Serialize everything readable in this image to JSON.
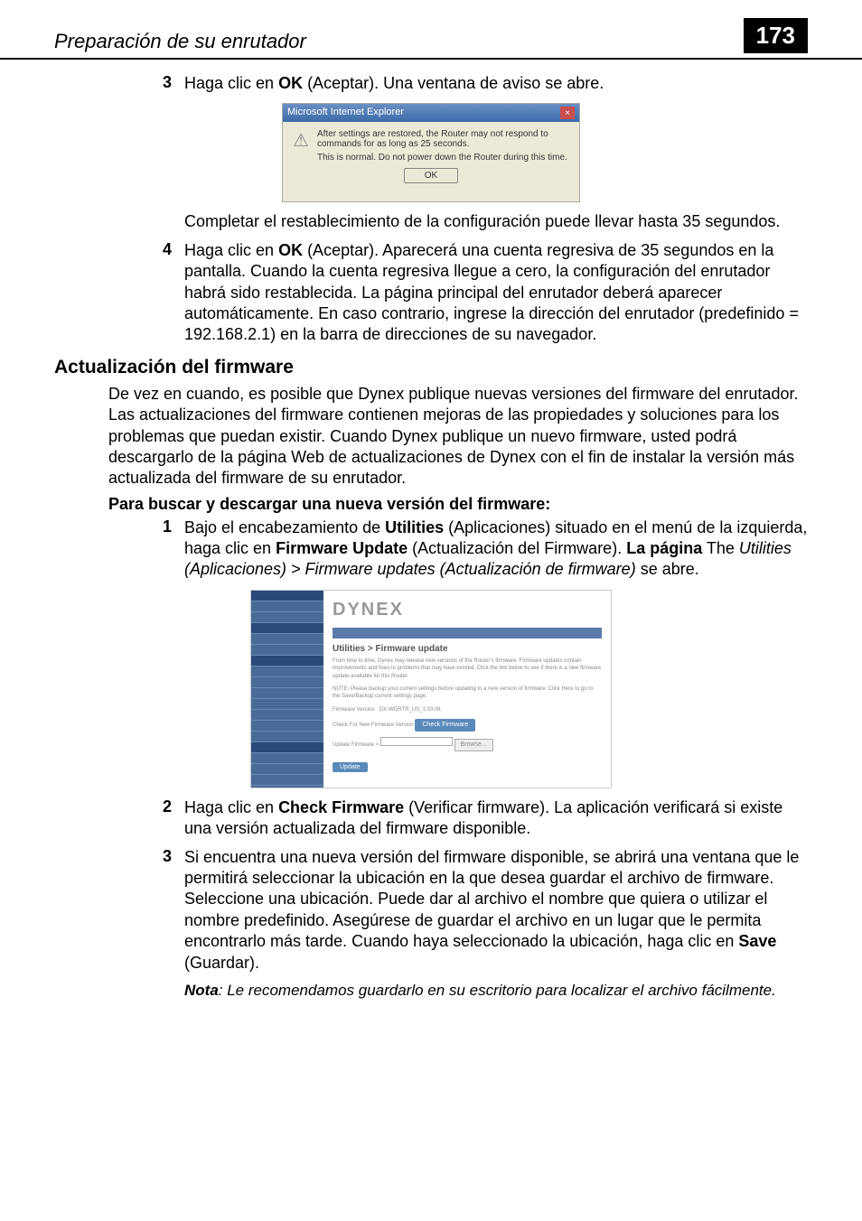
{
  "header": {
    "title": "Preparación de su enrutador",
    "page_number": "173"
  },
  "step3": {
    "number": "3",
    "prefix": "Haga clic en ",
    "bold": "OK",
    "suffix": " (Aceptar). Una ventana de aviso se abre."
  },
  "dialog": {
    "title": "Microsoft Internet Explorer",
    "line1": "After settings are restored, the Router may not respond to commands for as long as 25 seconds.",
    "line2": "This is normal. Do not power down the Router during this time.",
    "button": "OK"
  },
  "after_dialog": "Completar el restablecimiento de la configuración puede llevar hasta 35 segundos.",
  "step4": {
    "number": "4",
    "prefix": "Haga clic en ",
    "bold": "OK",
    "suffix": " (Aceptar). Aparecerá una cuenta regresiva de 35 segundos en la pantalla. Cuando la cuenta regresiva llegue a cero, la configuración del enrutador habrá sido restablecida. La página principal del enrutador deberá aparecer automáticamente. En caso contrario, ingrese la dirección del enrutador (predefinido = 192.168.2.1) en la barra de direcciones de su navegador."
  },
  "firmware_heading": "Actualización del firmware",
  "firmware_para": "De vez en cuando, es posible que Dynex publique nuevas versiones del firmware del enrutador. Las actualizaciones del firmware contienen mejoras de las propiedades y soluciones para los problemas que puedan existir. Cuando Dynex publique un nuevo firmware, usted podrá descargarlo de la página Web de actualizaciones de Dynex con el fin de instalar la versión más actualizada del firmware de su enrutador.",
  "firmware_subheading": "Para buscar y descargar una nueva versión del firmware:",
  "fw_step1": {
    "number": "1",
    "part1": "Bajo el encabezamiento de ",
    "bold1": "Utilities",
    "part2": " (Aplicaciones) situado en el menú de la izquierda, haga clic en ",
    "bold2": "Firmware Update",
    "part3": " (Actualización del Firmware). ",
    "bold3": "La página",
    "part4": " The ",
    "ital1": "Utilities (Aplicaciones) > Firmware updates (Actualización de firmware)",
    "part5": " se abre."
  },
  "screenshot": {
    "logo": "DYNEX",
    "section_title": "Utilities > Firmware update",
    "desc1": "From time to time, Dynex may release new versions of the Router's firmware. Firmware updates contain improvements and fixes to problems that may have existed. Click the link below to see if there is a new firmware update available for this Router.",
    "desc2": "NOTE: Please backup your current settings before updating to a new version of firmware. Click Here to go to the Save/Backup current settings page.",
    "fv_label": "Firmware Version",
    "fv_value": "DX-WGRTR_US_1.03.06",
    "check_label": "Check For New Firmware Version",
    "check_button": "Check Firmware",
    "update_label": "Update Firmware >",
    "browse": "Browse...",
    "update_btn": "Update"
  },
  "fw_step2": {
    "number": "2",
    "prefix": "Haga clic en ",
    "bold": "Check Firmware",
    "suffix": " (Verificar firmware). La aplicación verificará si existe una versión actualizada del firmware disponible."
  },
  "fw_step3": {
    "number": "3",
    "text": "Si encuentra una nueva versión del firmware disponible, se abrirá una ventana que le permitirá seleccionar la ubicación en la que desea guardar el archivo de firmware. Seleccione una ubicación. Puede dar al archivo el nombre que quiera o utilizar el nombre predefinido. Asegúrese de guardar el archivo en un lugar que le permita encontrarlo más tarde. Cuando haya seleccionado la ubicación, haga clic en ",
    "bold": "Save",
    "suffix": " (Guardar)."
  },
  "note": {
    "label": "Nota",
    "text": ": Le recomendamos guardarlo en su escritorio para localizar el archivo fácilmente."
  }
}
